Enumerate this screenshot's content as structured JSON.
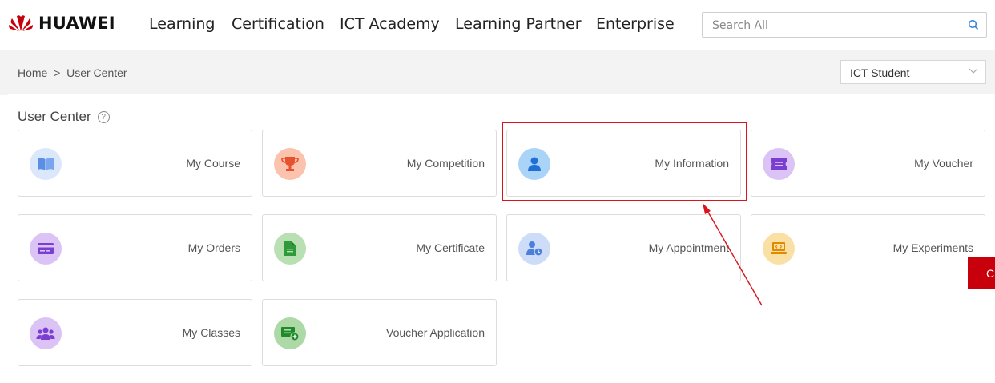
{
  "brand": {
    "name": "HUAWEI",
    "logo_icon": "huawei-flower-logo",
    "logo_color": "#c7000b"
  },
  "nav": [
    "Learning",
    "Certification",
    "ICT Academy",
    "Learning Partner",
    "Enterprise"
  ],
  "search": {
    "placeholder": "Search All",
    "icon": "search-icon"
  },
  "breadcrumb": {
    "home": "Home",
    "sep": ">",
    "current": "User Center"
  },
  "role_select": {
    "value": "ICT Student"
  },
  "user_center": {
    "title": "User Center",
    "help": "?"
  },
  "cards": [
    {
      "label": "My Course",
      "icon": "book-icon",
      "color": "#a9c6f3"
    },
    {
      "label": "My Competition",
      "icon": "trophy-icon",
      "color": "#f6a98b"
    },
    {
      "label": "My Information",
      "icon": "person-icon",
      "color": "#8cc8f5"
    },
    {
      "label": "My Voucher",
      "icon": "ticket-icon",
      "color": "#c9a6ef"
    },
    {
      "label": "My Orders",
      "icon": "card-icon",
      "color": "#c9a6ef"
    },
    {
      "label": "My Certificate",
      "icon": "document-icon",
      "color": "#a8d8a0"
    },
    {
      "label": "My Appointment",
      "icon": "user-clock-icon",
      "color": "#b8cdf2"
    },
    {
      "label": "My Experiments",
      "icon": "laptop-code-icon",
      "color": "#f8d48a"
    },
    {
      "label": "My Classes",
      "icon": "group-icon",
      "color": "#c9a6ef"
    },
    {
      "label": "Voucher Application",
      "icon": "voucher-add-icon",
      "color": "#8fc98a"
    }
  ],
  "floating_tab": {
    "label": "C"
  },
  "annotation": {
    "highlight_color": "#d9141c",
    "target": "My Information"
  }
}
